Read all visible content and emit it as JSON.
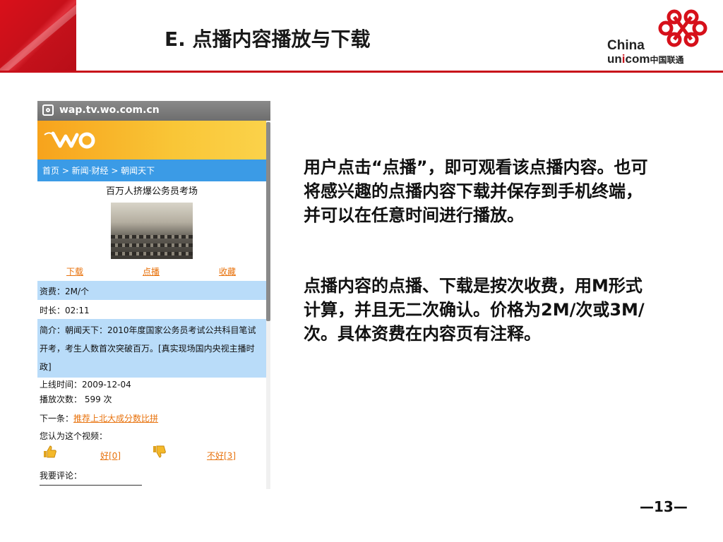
{
  "header": {
    "title": "E. 点播内容播放与下载",
    "logo_text_1": "China",
    "logo_text_2a": "un",
    "logo_text_2b": "i",
    "logo_text_2c": "com",
    "logo_text_2d": "中国联通",
    "colors": {
      "accent": "#c8101a"
    }
  },
  "phone": {
    "url": "wap.tv.wo.com.cn",
    "breadcrumb": "首页 > 新闻·财经 > 朝闻天下",
    "video_title": "百万人挤爆公务员考场",
    "actions": [
      "下载",
      "点播",
      "收藏"
    ],
    "fee": "资费：2M/个",
    "duration": "时长：02:11",
    "description": "简介：朝闻天下：2010年度国家公务员考试公共科目笔试开考，考生人数首次突破百万。[真实现场国内央视主播时政]",
    "online_time": "上线时间：2009-12-04",
    "play_count": "播放次数： 599 次",
    "next_label": "下一条：",
    "next_link": "推荐上北大成分数比拼",
    "opinion": "您认为这个视频：",
    "vote_good": "好[0]",
    "vote_bad": "不好[3]",
    "comment_label": "我要评论：",
    "colors": {
      "link": "#e8720c",
      "band": "#b9dcf9",
      "crumb": "#3b9be6"
    }
  },
  "body": {
    "paragraph_1": "用户点击“点播”，即可观看该点播内容。也可将感兴趣的点播内容下载并保存到手机终端，并可以在任意时间进行播放。",
    "paragraph_2": "点播内容的点播、下载是按次收费，用M形式计算，并且无二次确认。价格为2M/次或3M/次。具体资费在内容页有注释。"
  },
  "footer": {
    "page_number": "—13—"
  }
}
